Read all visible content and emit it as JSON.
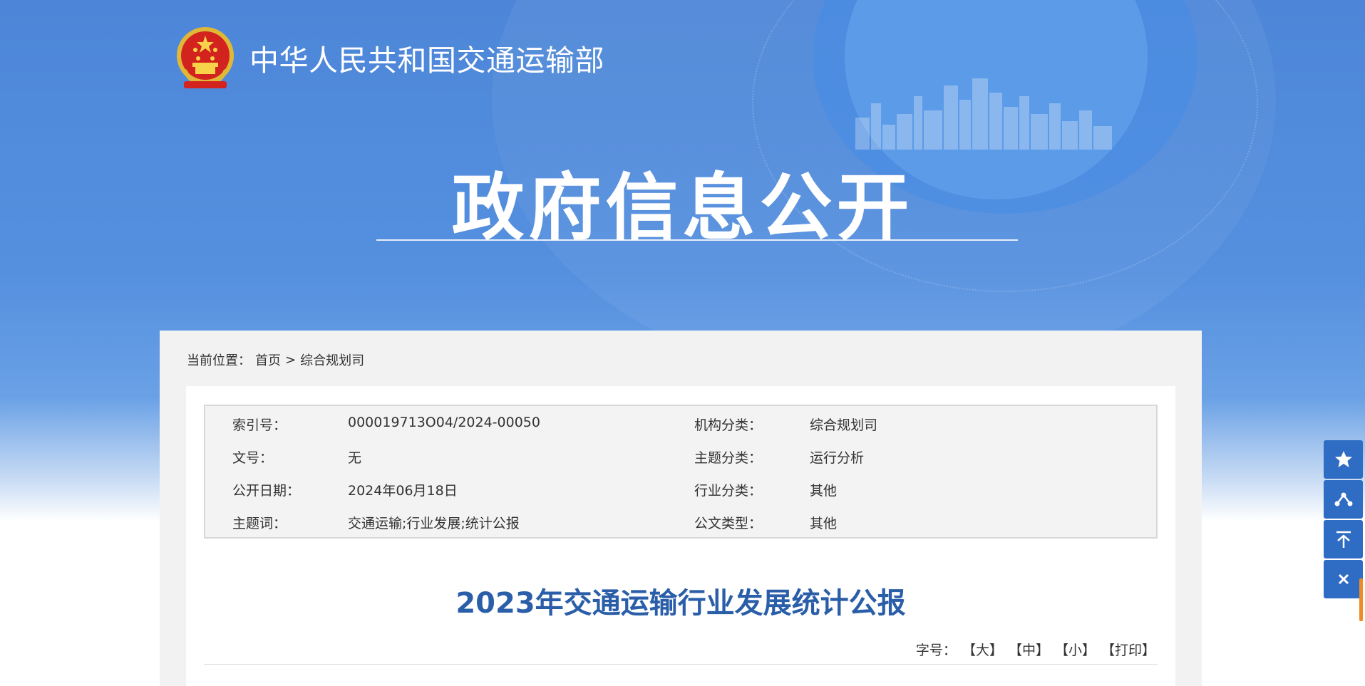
{
  "header": {
    "ministry_name": "中华人民共和国交通运输部",
    "hero_title": "政府信息公开"
  },
  "breadcrumb": {
    "label": "当前位置：",
    "home": "首页",
    "separator": ">",
    "current": "综合规划司"
  },
  "meta": {
    "rows": [
      {
        "k1": "索引号：",
        "v1": "000019713O04/2024-00050",
        "k2": "机构分类：",
        "v2": "综合规划司"
      },
      {
        "k1": "文号：",
        "v1": "无",
        "k2": "主题分类：",
        "v2": "运行分析"
      },
      {
        "k1": "公开日期：",
        "v1": "2024年06月18日",
        "k2": "行业分类：",
        "v2": "其他"
      },
      {
        "k1": "主题词：",
        "v1": "交通运输;行业发展;统计公报",
        "k2": "公文类型：",
        "v2": "其他"
      }
    ]
  },
  "article": {
    "title": "2023年交通运输行业发展统计公报"
  },
  "font_tools": {
    "label": "字号：",
    "large": "【大】",
    "medium": "【中】",
    "small": "【小】",
    "print": "【打印】"
  },
  "sidebar": {
    "icons": [
      "star-icon",
      "share-icon",
      "back-to-top-icon",
      "close-icon"
    ]
  },
  "colors": {
    "banner_blue": "#4d86d8",
    "title_blue": "#2a5ea8",
    "sidebar_blue": "#2f6cc4"
  }
}
